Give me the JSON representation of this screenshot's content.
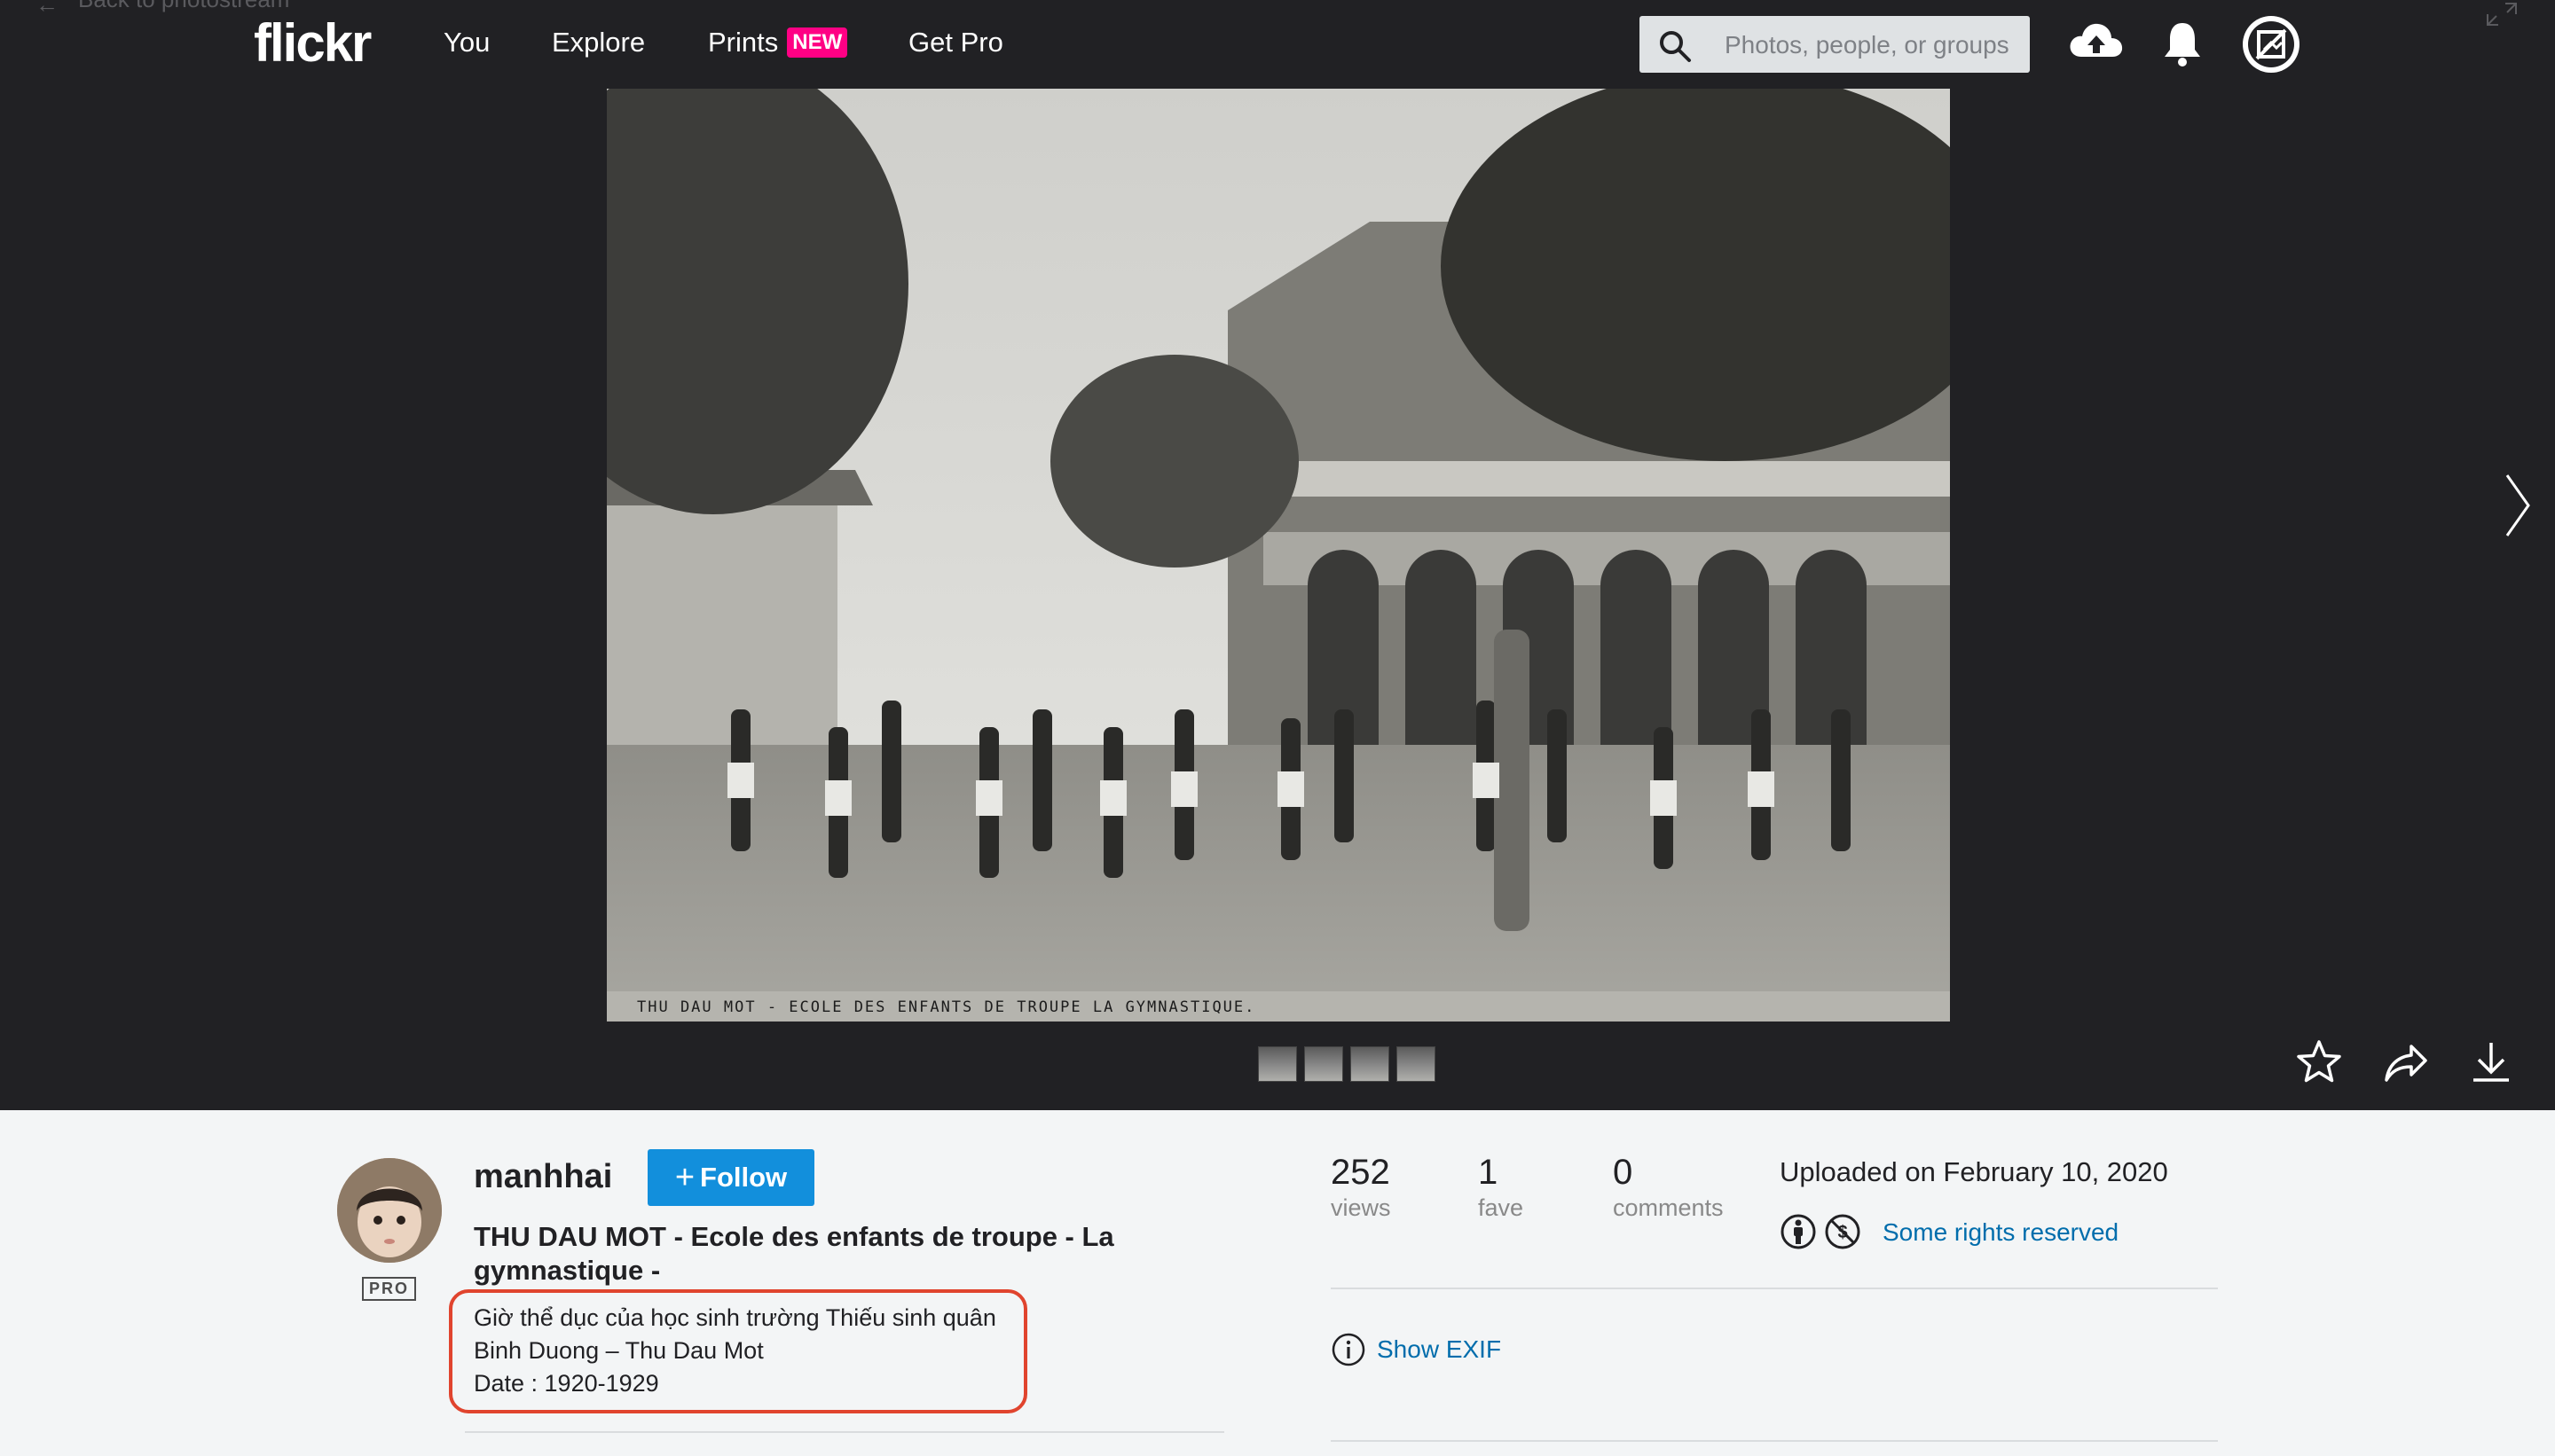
{
  "nav": {
    "back_label": "Back to photostream",
    "logo": "flickr",
    "you": "You",
    "explore": "Explore",
    "prints": "Prints",
    "prints_badge": "NEW",
    "get_pro": "Get Pro",
    "search_placeholder": "Photos, people, or groups",
    "icons": [
      "search-icon",
      "upload-cloud-icon",
      "notifications-bell-icon",
      "account-avatar-icon"
    ]
  },
  "photo": {
    "strip_caption": "THU DAU MOT - ECOLE DES ENFANTS DE TROUPE LA GYMNASTIQUE.",
    "thumbnail_count": 4,
    "actions": [
      "favorite-star-icon",
      "share-icon",
      "download-icon"
    ]
  },
  "owner": {
    "username": "manhhai",
    "pro_badge": "PRO",
    "follow_label": "Follow"
  },
  "details": {
    "title": "THU DAU MOT - Ecole des enfants de troupe - La gymnastique -",
    "description_lines": [
      "Giờ thể dục của học sinh trường Thiếu sinh quân",
      "Binh Duong – Thu Dau Mot",
      "Date : 1920-1929"
    ]
  },
  "stats": {
    "views_count": "252",
    "views_label": "views",
    "faves_count": "1",
    "faves_label": "fave",
    "comments_count": "0",
    "comments_label": "comments"
  },
  "meta": {
    "uploaded": "Uploaded on February 10, 2020",
    "license": "Some rights reserved",
    "show_exif": "Show EXIF"
  },
  "colors": {
    "nav_bg": "#212124",
    "accent_blue": "#128fdc",
    "link_blue": "#006dac",
    "prints_badge": "#ff0084",
    "highlight_box": "#e0442e"
  }
}
